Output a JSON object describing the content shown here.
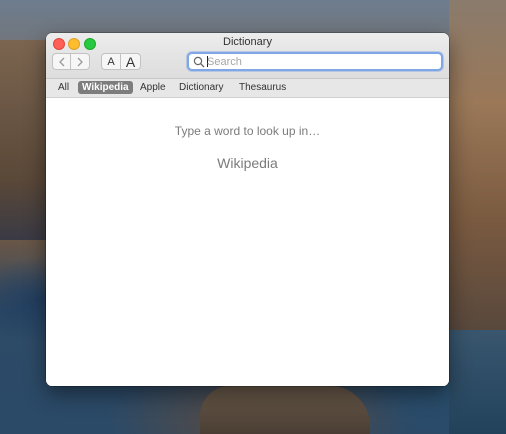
{
  "window": {
    "title": "Dictionary"
  },
  "toolbar": {
    "back_icon": "chevron-left-icon",
    "forward_icon": "chevron-right-icon",
    "font_smaller_label": "A",
    "font_larger_label": "A"
  },
  "search": {
    "placeholder": "Search",
    "value": "",
    "icon": "search-icon"
  },
  "sources": [
    {
      "label": "All",
      "active": false
    },
    {
      "label": "Wikipedia",
      "active": true
    },
    {
      "label": "Apple",
      "active": false
    },
    {
      "label": "Dictionary",
      "active": false
    },
    {
      "label": "Thesaurus",
      "active": false
    }
  ],
  "content": {
    "prompt": "Type a word to look up in…",
    "source_name": "Wikipedia"
  },
  "colors": {
    "search_focus": "#7fa7e6",
    "active_source_bg": "#7d7d7d",
    "traffic_close": "#fe5f57",
    "traffic_minimize": "#febc2e",
    "traffic_maximize": "#28c840"
  }
}
